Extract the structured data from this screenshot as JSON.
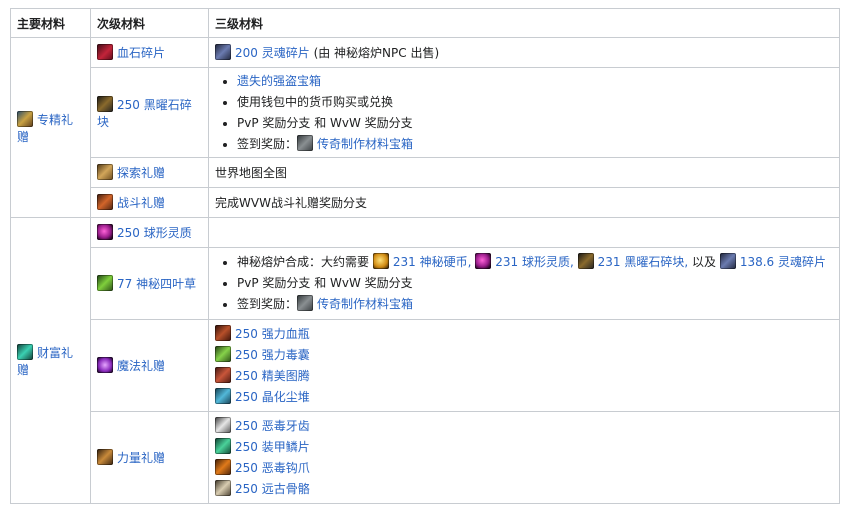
{
  "headers": {
    "primary": "主要材料",
    "secondary": "次级材料",
    "tertiary": "三级材料"
  },
  "groups": [
    {
      "name": "专精礼赠",
      "icon": "mastery-gift-icon"
    },
    {
      "name": "财富礼赠",
      "icon": "fortune-gift-icon"
    }
  ],
  "rows": {
    "bloodstone": {
      "name": "血石碎片",
      "icon": "bloodstone-shard-icon",
      "tertiary_link": "200 灵魂碎片",
      "tertiary_note": "(由 神秘熔炉NPC 出售)"
    },
    "obsidian": {
      "name": "250 黑曜石碎块",
      "icon": "obsidian-shard-icon",
      "items": [
        "遗失的强盗宝箱",
        "使用钱包中的货币购买或兑换",
        "PvP 奖励分支 和 WvW 奖励分支"
      ],
      "signin_label": "签到奖励：",
      "signin_link": "传奇制作材料宝箱"
    },
    "exploration": {
      "name": "探索礼赠",
      "icon": "exploration-gift-icon",
      "tertiary": "世界地图全图"
    },
    "battle": {
      "name": "战斗礼赠",
      "icon": "battle-gift-icon",
      "tertiary": "完成WVW战斗礼赠奖励分支"
    },
    "orb": {
      "name": "250 球形灵质",
      "icon": "crystalline-orb-icon"
    },
    "clover": {
      "name": "77 神秘四叶草",
      "icon": "mystic-clover-icon",
      "forge_label": "神秘熔炉合成：大约需要",
      "forge_coin": "231 神秘硬币,",
      "forge_orb": "231 球形灵质,",
      "forge_obsidian": "231 黑曜石碎块,",
      "forge_and": "以及",
      "forge_spirit": "138.6 灵魂碎片",
      "pvp": "PvP 奖励分支 和 WvW 奖励分支",
      "signin_label": "签到奖励：",
      "signin_link": "传奇制作材料宝箱"
    },
    "magic": {
      "name": "魔法礼赠",
      "icon": "magic-gift-icon",
      "items": [
        {
          "label": "250 强力血瓶",
          "icon": "powerful-blood-icon"
        },
        {
          "label": "250 强力毒囊",
          "icon": "powerful-venom-icon"
        },
        {
          "label": "250 精美图腾",
          "icon": "elaborate-totem-icon"
        },
        {
          "label": "250 晶化尘堆",
          "icon": "crystalline-dust-icon"
        }
      ]
    },
    "might": {
      "name": "力量礼赠",
      "icon": "might-gift-icon",
      "items": [
        {
          "label": "250 恶毒牙齿",
          "icon": "vicious-fang-icon"
        },
        {
          "label": "250 装甲鳞片",
          "icon": "armored-scale-icon"
        },
        {
          "label": "250 恶毒钩爪",
          "icon": "vicious-claw-icon"
        },
        {
          "label": "250 远古骨骼",
          "icon": "ancient-bone-icon"
        }
      ]
    }
  }
}
